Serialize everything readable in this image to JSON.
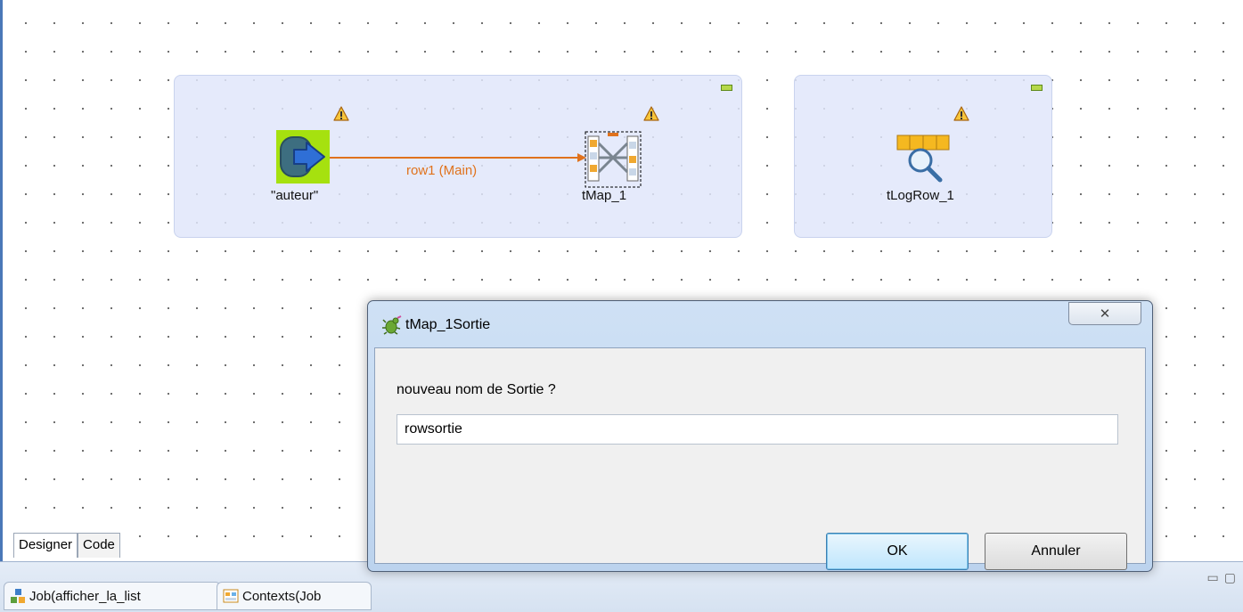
{
  "canvas": {
    "components": {
      "input": {
        "label": "\"auteur\""
      },
      "tmap": {
        "label": "tMap_1"
      },
      "logrow": {
        "label": "tLogRow_1"
      }
    },
    "link": {
      "label": "row1 (Main)"
    }
  },
  "designer_tabs": [
    {
      "label": "Designer",
      "active": true
    },
    {
      "label": "Code",
      "active": false
    }
  ],
  "bottom_tabs": [
    {
      "label": "Job(afficher_la_list",
      "icon": "job-icon"
    },
    {
      "label": "Contexts(Job",
      "icon": "contexts-icon"
    }
  ],
  "dialog": {
    "title": "tMap_1Sortie",
    "close_symbol": "✕",
    "prompt": "nouveau nom de Sortie ?",
    "input_value": "rowsortie",
    "ok_label": "OK",
    "cancel_label": "Annuler"
  },
  "colors": {
    "link": "#e0721c",
    "subjob_bg": "#e0e6fa",
    "input_component_bg": "#a6e10f",
    "dialog_frame": "#bcd3ee"
  }
}
